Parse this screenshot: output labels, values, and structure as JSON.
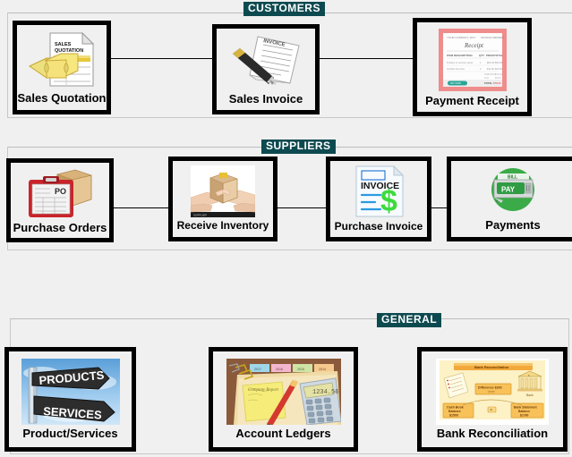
{
  "window": {
    "background_color": "#f0f0f0",
    "accent_color": "#0d4a50",
    "tile_border_color": "#000000"
  },
  "groups": [
    {
      "id": "customers",
      "legend": "CUSTOMERS",
      "tiles": [
        {
          "id": "sales-quotation",
          "label": "Sales Quotation",
          "icon": "sales-quotation-icon"
        },
        {
          "id": "sales-invoice",
          "label": "Sales Invoice",
          "icon": "sales-invoice-icon"
        },
        {
          "id": "payment-receipt",
          "label": "Payment Receipt",
          "icon": "payment-receipt-icon"
        }
      ]
    },
    {
      "id": "suppliers",
      "legend": "SUPPLIERS",
      "tiles": [
        {
          "id": "purchase-orders",
          "label": "Purchase Orders",
          "icon": "purchase-orders-icon"
        },
        {
          "id": "receive-inventory",
          "label": "Receive Inventory",
          "icon": "receive-inventory-icon"
        },
        {
          "id": "purchase-invoice",
          "label": "Purchase Invoice",
          "icon": "purchase-invoice-icon"
        },
        {
          "id": "payments",
          "label": "Payments",
          "icon": "payments-icon"
        }
      ]
    },
    {
      "id": "general",
      "legend": "GENERAL",
      "tiles": [
        {
          "id": "product-services",
          "label": "Product/Services",
          "icon": "product-services-icon"
        },
        {
          "id": "account-ledgers",
          "label": "Account Ledgers",
          "icon": "account-ledgers-icon"
        },
        {
          "id": "bank-reconciliation",
          "label": "Bank Reconciliation",
          "icon": "bank-reconciliation-icon"
        }
      ]
    }
  ],
  "icon_text": {
    "sales_quotation_doc": "SALES QUOTATION",
    "purchase_orders_clipboard": "PO",
    "purchase_invoice_heading": "INVOICE",
    "purchase_invoice_currency": "$",
    "payments_bill": "BILL",
    "payments_pay": "PAY",
    "payment_receipt_heading": "Receipt",
    "product_sign_top": "PRODUCTS",
    "product_sign_bottom": "SERVICES",
    "bank_rec_title": "Bank Reconciliation",
    "bank_rec_diff": "Difference  $260",
    "bank_rec_cashbook": "Cash Book Balance $1500",
    "bank_rec_statement": "Bank Statement Balance $1760",
    "bank_rec_bank": "Bank"
  }
}
